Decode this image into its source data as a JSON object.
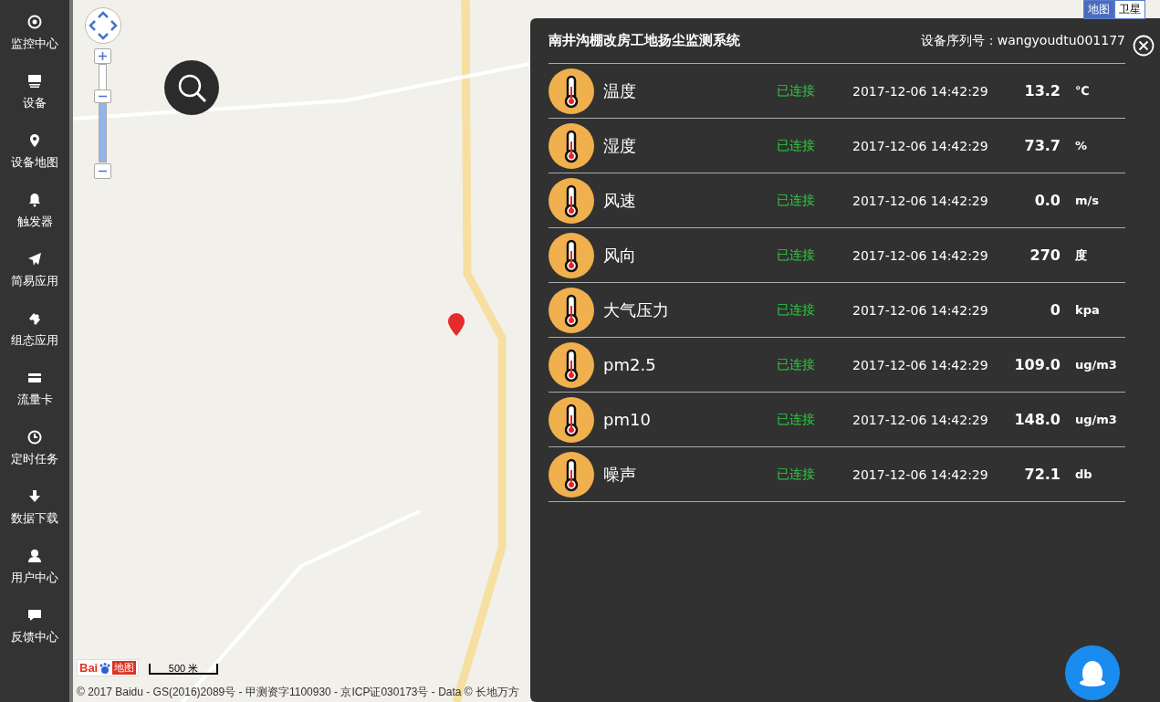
{
  "sidebar": {
    "items": [
      {
        "label": "监控中心"
      },
      {
        "label": "设备"
      },
      {
        "label": "设备地图"
      },
      {
        "label": "触发器"
      },
      {
        "label": "简易应用"
      },
      {
        "label": "组态应用"
      },
      {
        "label": "流量卡"
      },
      {
        "label": "定时任务"
      },
      {
        "label": "数据下载"
      },
      {
        "label": "用户中心"
      },
      {
        "label": "反馈中心"
      }
    ]
  },
  "map": {
    "logo": {
      "text": "Bai",
      "suffix": "地图"
    },
    "zoom": {
      "level": 0.73
    },
    "map_types": [
      {
        "label": "地图",
        "selected": true
      },
      {
        "label": "卫星",
        "selected": false
      }
    ],
    "scale": "500 米",
    "copyright": "© 2017 Baidu - GS(2016)2089号 - 甲测资字1100930 - 京ICP证030173号 - Data © 长地万方"
  },
  "panel": {
    "title": "南井沟棚改房工地扬尘监测系统",
    "serial": "设备序列号：wangyoudtu001177",
    "rows": [
      {
        "name": "温度",
        "status": "已连接",
        "time": "2017-12-06 14:42:29",
        "value": "13.2",
        "unit": "℃"
      },
      {
        "name": "湿度",
        "status": "已连接",
        "time": "2017-12-06 14:42:29",
        "value": "73.7",
        "unit": "%"
      },
      {
        "name": "风速",
        "status": "已连接",
        "time": "2017-12-06 14:42:29",
        "value": "0.0",
        "unit": "m/s"
      },
      {
        "name": "风向",
        "status": "已连接",
        "time": "2017-12-06 14:42:29",
        "value": "270",
        "unit": "度"
      },
      {
        "name": "大气压力",
        "status": "已连接",
        "time": "2017-12-06 14:42:29",
        "value": "0",
        "unit": "kpa"
      },
      {
        "name": "pm2.5",
        "status": "已连接",
        "time": "2017-12-06 14:42:29",
        "value": "109.0",
        "unit": "ug/m3"
      },
      {
        "name": "pm10",
        "status": "已连接",
        "time": "2017-12-06 14:42:29",
        "value": "148.0",
        "unit": "ug/m3"
      },
      {
        "name": "噪声",
        "status": "已连接",
        "time": "2017-12-06 14:42:29",
        "value": "72.1",
        "unit": "db"
      }
    ]
  }
}
